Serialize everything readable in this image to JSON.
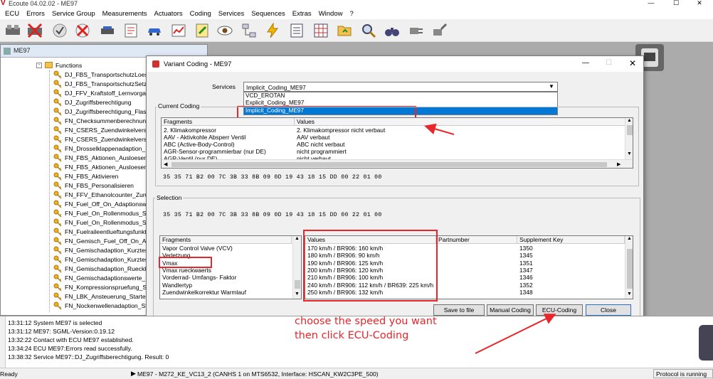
{
  "app": {
    "title": "Ecoute 04.02.02 - ME97",
    "logo_glyph": "V"
  },
  "menu": [
    "ECU",
    "Errors",
    "Service Group",
    "Measurements",
    "Actuators",
    "Coding",
    "Services",
    "Sequences",
    "Extras",
    "Window",
    "?"
  ],
  "toolbar_icons": [
    "connect-icon",
    "disconnect-icon",
    "check-icon",
    "clear-errors-icon",
    "tool-icon",
    "document-icon",
    "car-icon",
    "graph-icon",
    "edit-doc-icon",
    "eye-icon",
    "network-icon",
    "lightning-icon",
    "panel-icon",
    "table-icon",
    "folder-icon",
    "search-icon",
    "binoculars-icon",
    "plug-in-icon",
    "plug-out-icon"
  ],
  "tree": {
    "window_title": "ME97",
    "root": "Functions",
    "items": [
      "DJ_FBS_TransportschutzLoese",
      "DJ_FBS_TransportschutzSetzer",
      "DJ_FFV_Kraftstoff_Lernvorgan",
      "DJ_Zugriffsberechtigung",
      "DJ_Zugriffsberechtigung_Flasl",
      "FN_Checksummenberechnun",
      "FN_CSERS_Zuendwinkelverste",
      "FN_CSERS_Zuendwinkelverste",
      "FN_Drosselklappenadaption_S",
      "FN_FBS_Aktionen_Ausloesen",
      "FN_FBS_Aktionen_Ausloesen_",
      "FN_FBS_Aktivieren",
      "FN_FBS_Personalisieren",
      "FN_FFV_Ethanolcounter_Zuruc",
      "FN_Fuel_Off_On_Adaptionswe",
      "FN_Fuel_On_Rollenmodus_Sta",
      "FN_Fuel_On_Rollenmodus_Sto",
      "FN_Fuelraileentlueftungsfunkti",
      "FN_Gemisch_Fuel_Off_On_Ad",
      "FN_Gemischadaption_Kurztes",
      "FN_Gemischadaption_Kurztes",
      "FN_Gemischadaption_Rueckk",
      "FN_Gemischadaptionswerte_L",
      "FN_Kompressionspruefung_St",
      "FN_LBK_Ansteuerung_Starten",
      "FN_Nockenwellenadaption_St"
    ]
  },
  "dialog": {
    "title": "Variant Coding - ME97",
    "services_label": "Services",
    "services_selected": "Implicit_Coding_ME97",
    "services_options": [
      "VCD_EROTAN",
      "Explicit_Coding_ME97",
      "Implicit_Coding_ME97"
    ],
    "current_coding": {
      "group_label": "Current Coding",
      "headers": [
        "Fragments",
        "Values"
      ],
      "rows": [
        [
          "2. Klimakompressor",
          "2. Klimakompressor nicht verbaut"
        ],
        [
          "AAV - Aktivkohle Absperr Ventil",
          "AAV verbaut"
        ],
        [
          "ABC (Active-Body-Control)",
          "ABC nicht verbaut"
        ],
        [
          "AGR-Sensor-programmierbar (nur DE)",
          "nicht programmiert"
        ],
        [
          "AGR-Ventil (nur DE)",
          "nicht verbaut"
        ]
      ],
      "hex": "35 35 71 B2 00 7C 3B 33 8B 09 0D 19 43 18 15 DD 00 22 01 00"
    },
    "selection": {
      "group_label": "Selection",
      "hex": "35 35 71 B2 00 7C 3B 33 8B 09 0D 19 43 18 15 DD 00 22 01 00",
      "fragments_header": "Fragments",
      "fragments": [
        "Vapor Control Valve (VCV)",
        "Verletzung",
        "Vmax",
        "Vmax rueckwaerts",
        "Vorderrad- Umfangs- Faktor",
        "Wandlertyp",
        "Zuendwinkelkorrektur Warmlauf"
      ],
      "values_headers": [
        "Values",
        "Partnumber",
        "Supplement Key"
      ],
      "values": [
        [
          "170 km/h / BR906: 160 km/h",
          "",
          "1350"
        ],
        [
          "180 km/h / BR906: 90 km/h",
          "",
          "1345"
        ],
        [
          "190 km/h / BR906: 125 km/h",
          "",
          "1351"
        ],
        [
          "200 km/h / BR906: 120 km/h",
          "",
          "1347"
        ],
        [
          "210 km/h / BR906: 100 km/h",
          "",
          "1346"
        ],
        [
          "240 km/h / BR906: 112 km/h / BR639: 225 km/h",
          "",
          "1352"
        ],
        [
          "250 km/h / BR906: 132 km/h",
          "",
          "1348"
        ]
      ]
    },
    "buttons": {
      "save": "Save to file",
      "manual": "Manual Coding",
      "ecu": "ECU-Coding",
      "close": "Close"
    }
  },
  "annotation": {
    "line1": "choose the speed you want",
    "line2": "then click ECU-Coding",
    "color": "#e8262b"
  },
  "log": [
    "13:31:12 System ME97 is selected",
    "13:31:12 ME97: SGML-Version:0.19.12",
    "13:32:22 Contact with ECU ME97 established.",
    "13:34:24 ECU ME97:Errors read successfully.",
    "13:38:32 Service ME97::DJ_Zugriffsberechtigung. Result: 0"
  ],
  "status": {
    "left": "Ready",
    "center": "ME97 - M272_KE_VC13_2 (CANHS 1 on MTS6532, Interface: HSCAN_KW2C3PE_500)",
    "right": "Protocol is running"
  }
}
